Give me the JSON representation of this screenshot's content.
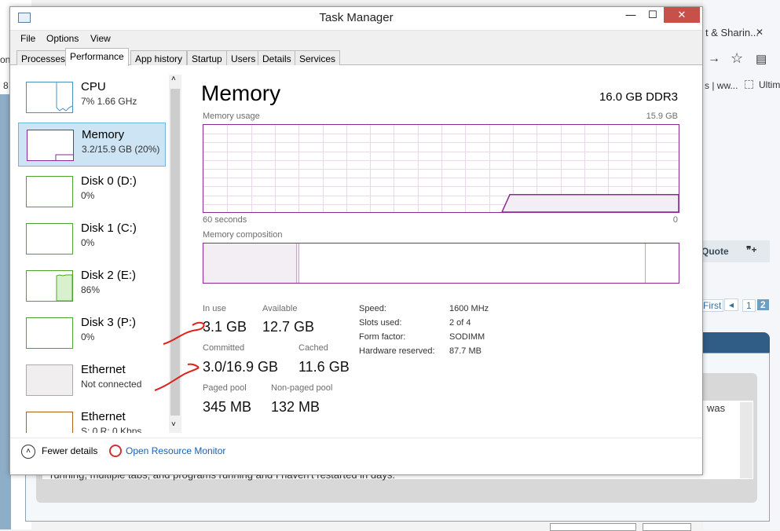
{
  "window": {
    "title": "Task Manager",
    "minimize": "—",
    "maximize": "☐",
    "close": "✕"
  },
  "menu": [
    "File",
    "Options",
    "View"
  ],
  "tabs": [
    "Processes",
    "Performance",
    "App history",
    "Startup",
    "Users",
    "Details",
    "Services"
  ],
  "active_tab": "Performance",
  "sidebar": [
    {
      "name": "CPU",
      "sub": "7% 1.66 GHz",
      "color": "#4a90bf"
    },
    {
      "name": "Memory",
      "sub": "3.2/15.9 GB (20%)",
      "color": "#8b2a95"
    },
    {
      "name": "Disk 0 (D:)",
      "sub": "0%",
      "color": "#4da42a"
    },
    {
      "name": "Disk 1 (C:)",
      "sub": "0%",
      "color": "#4da42a"
    },
    {
      "name": "Disk 2 (E:)",
      "sub": "86%",
      "color": "#4da42a"
    },
    {
      "name": "Disk 3 (P:)",
      "sub": "0%",
      "color": "#4da42a"
    },
    {
      "name": "Ethernet",
      "sub": "Not connected",
      "color": "#aaaaaa"
    },
    {
      "name": "Ethernet",
      "sub": "S: 0 R: 0 Kbps",
      "color": "#a8621a"
    }
  ],
  "main": {
    "title": "Memory",
    "spec": "16.0 GB DDR3",
    "usage_label": "Memory usage",
    "usage_max": "15.9 GB",
    "time_label": "60 seconds",
    "time_end": "0",
    "composition_label": "Memory composition",
    "usage_fraction_current": 0.2,
    "stats": {
      "in_use_label": "In use",
      "in_use": "3.1 GB",
      "available_label": "Available",
      "available": "12.7 GB",
      "committed_label": "Committed",
      "committed": "3.0/16.9 GB",
      "cached_label": "Cached",
      "cached": "11.6 GB",
      "paged_label": "Paged pool",
      "paged": "345 MB",
      "nonpaged_label": "Non-paged pool",
      "nonpaged": "132 MB"
    },
    "specs": [
      {
        "k": "Speed:",
        "v": "1600 MHz"
      },
      {
        "k": "Slots used:",
        "v": "2 of 4"
      },
      {
        "k": "Form factor:",
        "v": "SODIMM"
      },
      {
        "k": "Hardware reserved:",
        "v": "87.7 MB"
      }
    ]
  },
  "footer": {
    "fewer": "Fewer details",
    "monitor": "Open Resource Monitor"
  },
  "background": {
    "tab": "t & Sharin...",
    "bookmark1": "s | ww...",
    "bookmark2": "Ultim",
    "quote": "Quote",
    "first": "First",
    "page1": "1",
    "page2": "2",
    "was": "was",
    "left_frag1": "on",
    "left_frag2": "8",
    "bottom_text": "running, multiple tabs, and programs running and I haven't restarted in days."
  },
  "colors": {
    "memory": "#8b2a95",
    "accent_link": "#1a5fb4",
    "close": "#c7504a",
    "annotation": "#e0201a"
  }
}
